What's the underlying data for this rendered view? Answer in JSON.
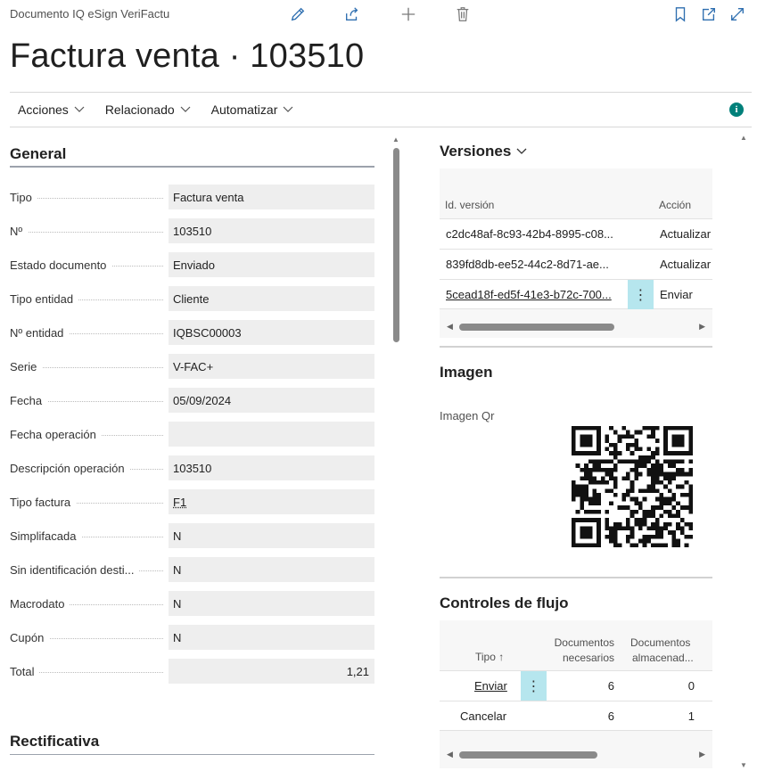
{
  "header": {
    "doc_kind": "Documento IQ eSign VeriFactu",
    "title": "Factura venta · 103510"
  },
  "toolbar": {
    "icons": [
      "edit-icon",
      "share-icon",
      "new-icon",
      "delete-icon",
      "bookmark-icon",
      "open-new-window-icon",
      "expand-icon"
    ]
  },
  "menu": {
    "acciones": "Acciones",
    "relacionado": "Relacionado",
    "automatizar": "Automatizar",
    "info": "i"
  },
  "general": {
    "title": "General",
    "fields": [
      {
        "label": "Tipo",
        "value": "Factura venta"
      },
      {
        "label": "Nº",
        "value": "103510"
      },
      {
        "label": "Estado documento",
        "value": "Enviado"
      },
      {
        "label": "Tipo entidad",
        "value": "Cliente"
      },
      {
        "label": "Nº entidad",
        "value": "IQBSC00003"
      },
      {
        "label": "Serie",
        "value": "V-FAC+"
      },
      {
        "label": "Fecha",
        "value": "05/09/2024"
      },
      {
        "label": "Fecha operación",
        "value": ""
      },
      {
        "label": "Descripción operación",
        "value": "103510"
      },
      {
        "label": "Tipo factura",
        "value": "F1"
      },
      {
        "label": "Simplifacada",
        "value": "N"
      },
      {
        "label": "Sin identificación desti...",
        "value": "N"
      },
      {
        "label": "Macrodato",
        "value": "N"
      },
      {
        "label": "Cupón",
        "value": "N"
      },
      {
        "label": "Total",
        "value": "1,21"
      }
    ]
  },
  "rectificativa": {
    "title": "Rectificativa"
  },
  "versiones": {
    "title": "Versiones",
    "col_id": "Id. versión",
    "col_accion": "Acción",
    "rows": [
      {
        "id": "c2dc48af-8c93-42b4-8995-c08...",
        "accion": "Actualizar"
      },
      {
        "id": "839fd8db-ee52-44c2-8d71-ae...",
        "accion": "Actualizar"
      },
      {
        "id": "5cead18f-ed5f-41e3-b72c-700...",
        "accion": "Enviar"
      }
    ],
    "row_menu": "⋮"
  },
  "imagen": {
    "title": "Imagen",
    "qr_label": "Imagen Qr"
  },
  "controles": {
    "title": "Controles de flujo",
    "col_tipo": "Tipo ↑",
    "col_nec_1": "Documentos",
    "col_nec_2": "necesarios",
    "col_alm_1": "Documentos",
    "col_alm_2": "almacenad...",
    "rows": [
      {
        "tipo": "Enviar",
        "necesarios": "6",
        "almacenados": "0"
      },
      {
        "tipo": "Cancelar",
        "necesarios": "6",
        "almacenados": "1"
      }
    ],
    "row_menu": "⋮"
  }
}
